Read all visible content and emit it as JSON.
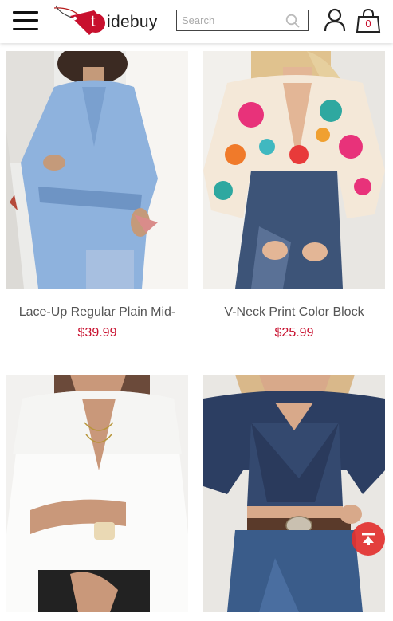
{
  "header": {
    "brand": "idebuy",
    "brand_initial": "t",
    "search_placeholder": "Search",
    "cart_count": "0",
    "icons": [
      "menu-icon",
      "search-icon",
      "user-icon",
      "shopping-bag-icon",
      "back-to-top-icon"
    ]
  },
  "products": [
    {
      "name": "Lace-Up Regular Plain Mid-",
      "price": "$39.99"
    },
    {
      "name": "V-Neck Print Color Block",
      "price": "$25.99"
    },
    {
      "name": "",
      "price": ""
    },
    {
      "name": "",
      "price": ""
    }
  ],
  "colors": {
    "accent": "#c8102e",
    "back_to_top": "#e3312f",
    "name_text": "#555555"
  }
}
